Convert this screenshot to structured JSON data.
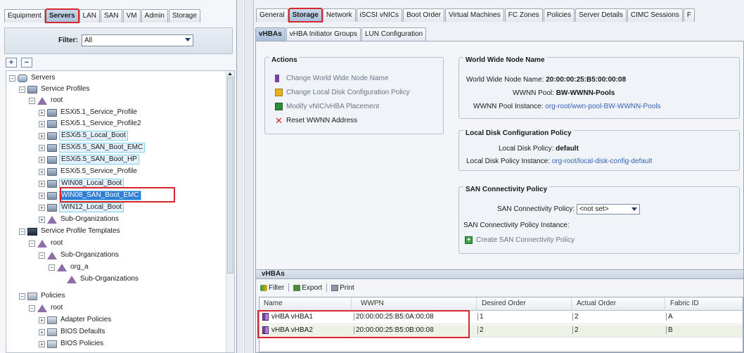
{
  "left_tabs": [
    "Equipment",
    "Servers",
    "LAN",
    "SAN",
    "VM",
    "Admin",
    "Storage"
  ],
  "left_active_tab": "Servers",
  "filter": {
    "label": "Filter:",
    "value": "All"
  },
  "tree_tools": {
    "expand": "+",
    "collapse": "−"
  },
  "tree": [
    {
      "label": "Servers",
      "icon": "servers-icon"
    },
    {
      "label": "Service Profiles",
      "icon": "service-profile-folder-icon"
    },
    {
      "label": "root",
      "icon": "org-icon"
    },
    {
      "label": "ESXi5.1_Service_Profile",
      "icon": "service-profile-icon"
    },
    {
      "label": "ESXi5.1_Service_Profile2",
      "icon": "service-profile-icon"
    },
    {
      "label": "ESXi5.5_Local_Boot",
      "icon": "service-profile-icon"
    },
    {
      "label": "ESXi5.5_SAN_Boot_EMC",
      "icon": "service-profile-icon"
    },
    {
      "label": "ESXi5.5_SAN_Boot_HP",
      "icon": "service-profile-icon"
    },
    {
      "label": "ESXi5.5_Service_Profile",
      "icon": "service-profile-icon"
    },
    {
      "label": "WIN08_Local_Boot",
      "icon": "service-profile-icon"
    },
    {
      "label": "WIN08_SAN_Boot_EMC",
      "icon": "service-profile-icon"
    },
    {
      "label": "WIN12_Local_Boot",
      "icon": "service-profile-icon"
    },
    {
      "label": "Sub-Organizations",
      "icon": "org-icon"
    },
    {
      "label": "Service Profile Templates",
      "icon": "template-icon"
    },
    {
      "label": "root",
      "icon": "org-icon"
    },
    {
      "label": "Sub-Organizations",
      "icon": "org-icon"
    },
    {
      "label": "org_a",
      "icon": "org-icon"
    },
    {
      "label": "Sub-Organizations",
      "icon": "org-icon"
    },
    {
      "label": "Policies",
      "icon": "policy-icon"
    },
    {
      "label": "root",
      "icon": "org-icon"
    },
    {
      "label": "Adapter Policies",
      "icon": "policy-icon"
    },
    {
      "label": "BIOS Defaults",
      "icon": "policy-icon"
    },
    {
      "label": "BIOS Policies",
      "icon": "policy-icon"
    }
  ],
  "right_tabs": [
    "General",
    "Storage",
    "Network",
    "iSCSI vNICs",
    "Boot Order",
    "Virtual Machines",
    "FC Zones",
    "Policies",
    "Server Details",
    "CIMC Sessions",
    "F"
  ],
  "right_active_tab": "Storage",
  "sub_tabs": [
    "vHBAs",
    "vHBA Initiator Groups",
    "LUN Configuration"
  ],
  "sub_active_tab": "vHBAs",
  "actions": {
    "title": "Actions",
    "items": [
      "Change World Wide Node Name",
      "Change Local Disk Configuration Policy",
      "Modify vNIC/vHBA Placement",
      "Reset WWNN Address"
    ]
  },
  "wwnn": {
    "title": "World Wide Node Name",
    "name_label": "World Wide Node Name:",
    "name_value": "20:00:00:25:B5:00:00:08",
    "pool_label": "WWNN Pool:",
    "pool_value": "BW-WWNN-Pools",
    "instance_label": "WWNN Pool Instance:",
    "instance_value": "org-root/wwn-pool-BW-WWNN-Pools"
  },
  "local_disk": {
    "title": "Local Disk Configuration Policy",
    "policy_label": "Local Disk Policy:",
    "policy_value": "default",
    "instance_label": "Local Disk Policy Instance:",
    "instance_value": "org-root/local-disk-config-default"
  },
  "san": {
    "title": "SAN Connectivity Policy",
    "policy_label": "SAN Connectivity Policy:",
    "policy_value": "<not set>",
    "instance_label": "SAN Connectivity Policy Instance:",
    "create_label": "Create SAN Connectivity Policy"
  },
  "vhbas": {
    "title": "vHBAs",
    "toolbar": {
      "filter": "Filter",
      "export": "Export",
      "print": "Print"
    },
    "columns": [
      "Name",
      "WWPN",
      "Desired Order",
      "Actual Order",
      "Fabric ID"
    ],
    "rows": [
      [
        "vHBA vHBA1",
        "20:00:00:25:B5:0A:00:08",
        "1",
        "2",
        "A"
      ],
      [
        "vHBA vHBA2",
        "20:00:00:25:B5:0B:00:08",
        "2",
        "2",
        "B"
      ]
    ]
  },
  "colors": {
    "highlight_red": "#d7262c",
    "link_blue": "#3463b5",
    "selection_blue": "#2f7fd6"
  }
}
